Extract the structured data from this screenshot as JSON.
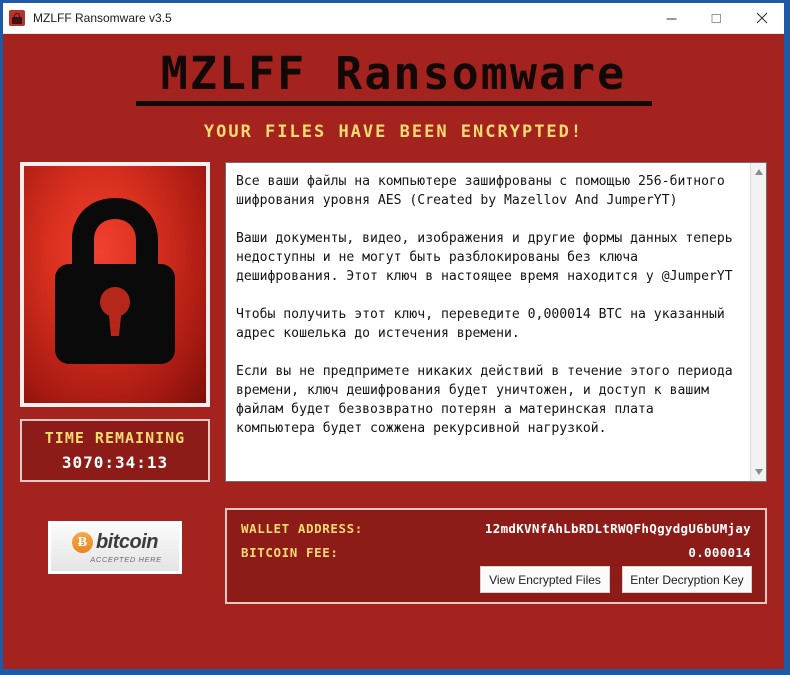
{
  "window": {
    "title": "MZLFF Ransomware v3.5",
    "icon": "padlock-icon",
    "minimize_label": "–",
    "maximize_label": "□",
    "close_label": "✕"
  },
  "header": {
    "title": "MZLFF Ransomware",
    "subtitle": "YOUR FILES HAVE BEEN ENCRYPTED!",
    "title_color": "#120806",
    "subtitle_color": "#fada72",
    "background_color": "#a4231f"
  },
  "lock_panel": {
    "icon": "padlock-icon",
    "background_color": "#d9301f"
  },
  "timer": {
    "label": "TIME REMAINING",
    "value": "3070:34:13",
    "label_color": "#fada72",
    "value_color": "#ffffff"
  },
  "bitcoin_badge": {
    "symbol": "Ƀ",
    "word": "bitcoin",
    "tagline": "ACCEPTED HERE",
    "coin_color": "#e8871e"
  },
  "note": {
    "text": "Все ваши файлы на компьютере зашифрованы с помощью 256-битного шифрования уровня AES (Created by Mazellov And JumperYT)\n\nВаши документы, видео, изображения и другие формы данных теперь недоступны и не могут быть разблокированы без ключа дешифрования. Этот ключ в настоящее время находится у @JumperYT\n\nЧтобы получить этот ключ, переведите 0,000014 BTC на указанный адрес кошелька до истечения времени.\n\nЕсли вы не предпримете никаких действий в течение этого периода времени, ключ дешифрования будет уничтожен, и доступ к вашим файлам будет безвозвратно потерян а материнская плата компьютера будет сожжена рекурсивной нагрузкой.",
    "scrollbar_up": "▲",
    "scrollbar_down": "▼"
  },
  "payment": {
    "wallet_label": "WALLET ADDRESS:",
    "wallet_value": "12mdKVNfAhLbRDLtRWQFhQgydgU6bUMjay",
    "fee_label": "BITCOIN FEE:",
    "fee_value": "0.000014",
    "view_files_button": "View Encrypted Files",
    "decryption_key_button": "Enter Decryption Key"
  }
}
